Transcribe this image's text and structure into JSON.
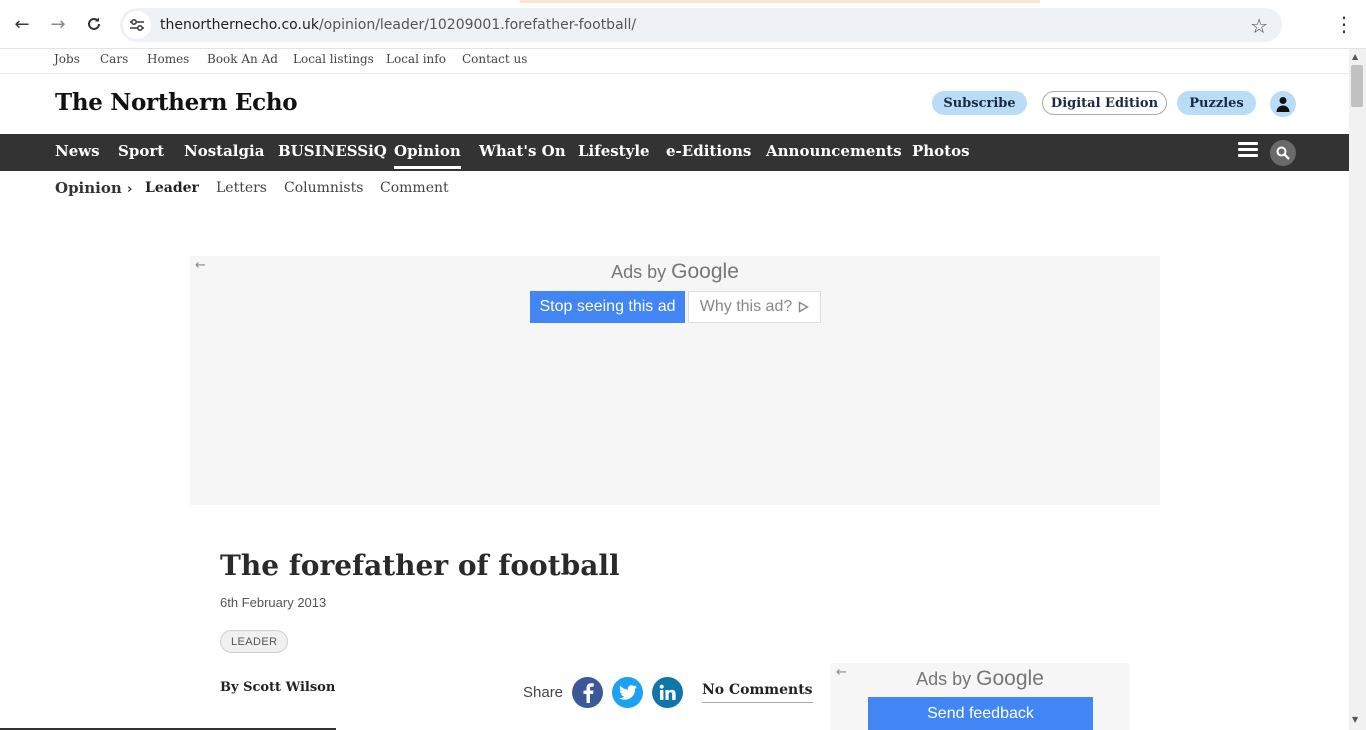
{
  "browser": {
    "url_host": "thenorthernecho.co.uk",
    "url_path": "/opinion/leader/10209001.forefather-football/"
  },
  "utility_links": [
    "Jobs",
    "Cars",
    "Homes",
    "Book An Ad",
    "Local listings",
    "Local info",
    "Contact us"
  ],
  "header": {
    "brand": "The Northern Echo",
    "subscribe": "Subscribe",
    "digital_edition": "Digital Edition",
    "puzzles": "Puzzles"
  },
  "main_nav": [
    "News",
    "Sport",
    "Nostalgia",
    "BUSINESSiQ",
    "Opinion",
    "What's On",
    "Lifestyle",
    "e-Editions",
    "Announcements",
    "Photos"
  ],
  "main_nav_active": "Opinion",
  "sub_nav": {
    "section": "Opinion",
    "items": [
      "Leader",
      "Letters",
      "Columnists",
      "Comment"
    ],
    "current": "Leader"
  },
  "ad_top": {
    "ads_by": "Ads by",
    "google": "Google",
    "stop_label": "Stop seeing this ad",
    "why_label": "Why this ad?"
  },
  "article": {
    "headline": "The forefather of football",
    "date": "6th February 2013",
    "tag": "LEADER",
    "byline": "By Scott Wilson",
    "share_label": "Share",
    "comments": "No Comments"
  },
  "ad_side": {
    "ads_by": "Ads by",
    "google": "Google",
    "feedback_label": "Send feedback"
  },
  "colors": {
    "nav_bg": "#333333",
    "pill_blue": "#b9dcf7",
    "ad_button": "#4285f4",
    "facebook": "#3b5998",
    "twitter": "#1da1f2",
    "linkedin": "#0e76a8"
  },
  "icons": {
    "back": "back-arrow-icon",
    "forward": "forward-arrow-icon",
    "reload": "reload-icon",
    "site_info": "site-info-icon",
    "bookmark": "star-icon",
    "browser_menu": "kebab-menu-icon",
    "account": "account-icon",
    "menu": "hamburger-menu-icon",
    "search": "search-icon",
    "chevron": "chevron-right-icon",
    "facebook": "facebook-icon",
    "twitter": "twitter-icon",
    "linkedin": "linkedin-icon"
  }
}
